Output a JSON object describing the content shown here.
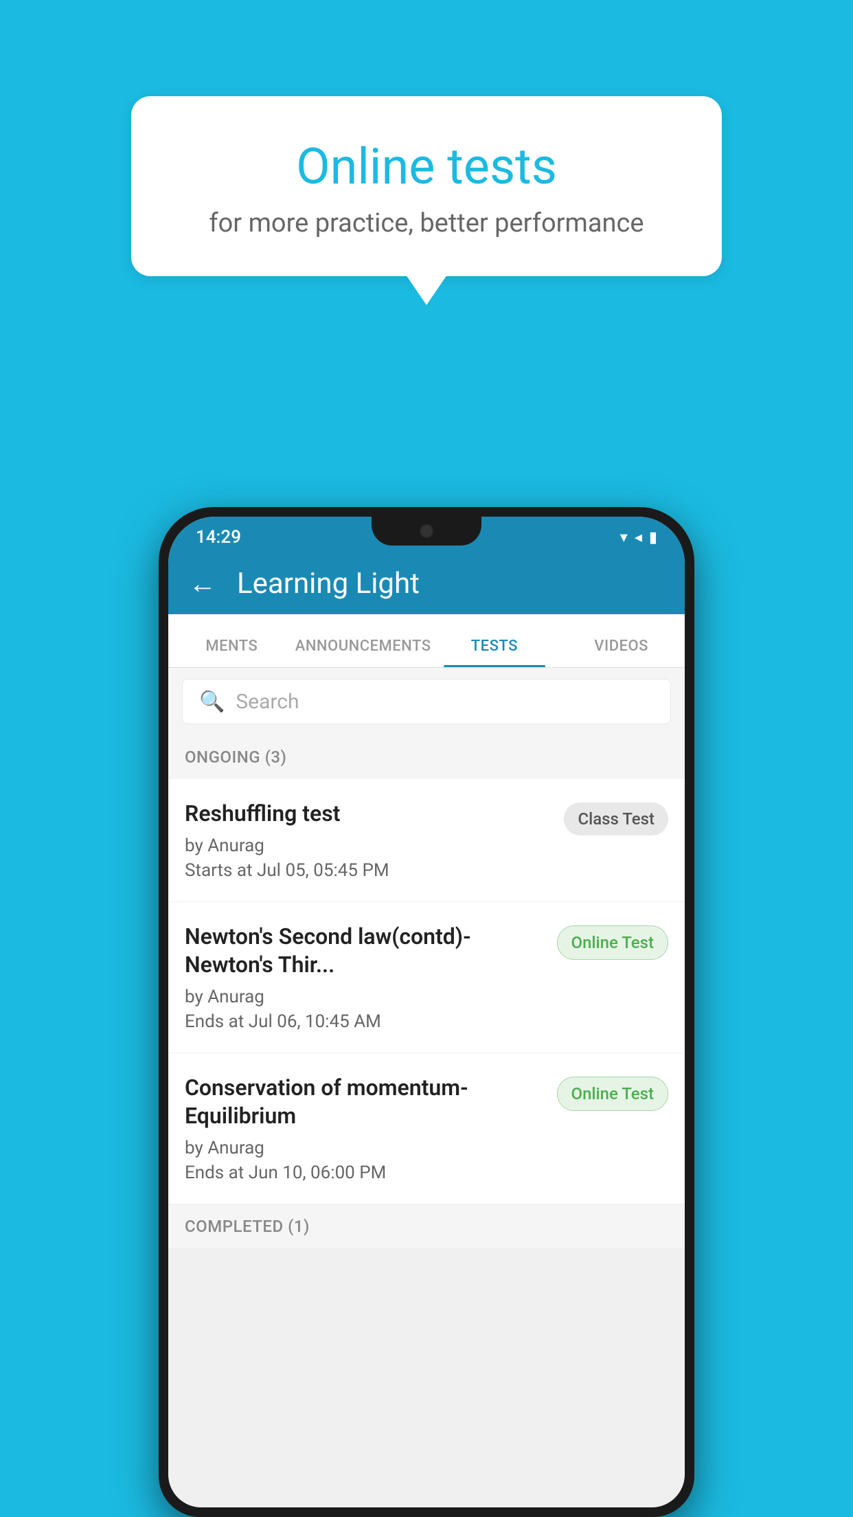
{
  "background_color": "#1BBAE1",
  "speech_bubble": {
    "title": "Online tests",
    "subtitle": "for more practice, better performance"
  },
  "app": {
    "name": "Learning Light",
    "status_bar": {
      "time": "14:29",
      "icons": "▾◂▮"
    },
    "tabs": [
      {
        "label": "MENTS",
        "active": false
      },
      {
        "label": "ANNOUNCEMENTS",
        "active": false
      },
      {
        "label": "TESTS",
        "active": true
      },
      {
        "label": "VIDEOS",
        "active": false
      }
    ],
    "search": {
      "placeholder": "Search"
    },
    "sections": [
      {
        "header": "ONGOING (3)",
        "items": [
          {
            "title": "Reshuffling test",
            "author": "by Anurag",
            "time": "Starts at  Jul 05, 05:45 PM",
            "badge": "Class Test",
            "badge_type": "class"
          },
          {
            "title": "Newton's Second law(contd)-Newton's Thir...",
            "author": "by Anurag",
            "time": "Ends at  Jul 06, 10:45 AM",
            "badge": "Online Test",
            "badge_type": "online"
          },
          {
            "title": "Conservation of momentum-Equilibrium",
            "author": "by Anurag",
            "time": "Ends at  Jun 10, 06:00 PM",
            "badge": "Online Test",
            "badge_type": "online"
          }
        ]
      },
      {
        "header": "COMPLETED (1)",
        "items": []
      }
    ]
  }
}
